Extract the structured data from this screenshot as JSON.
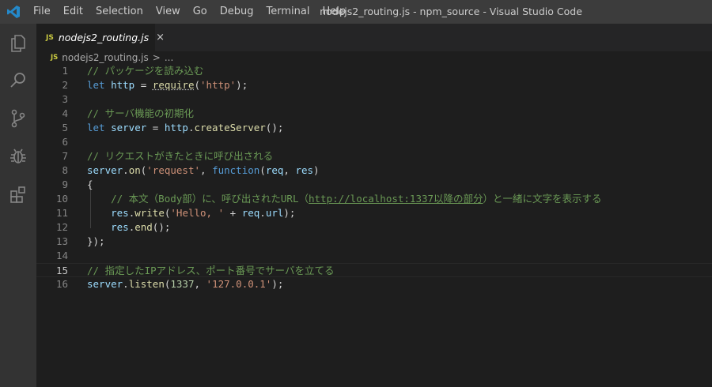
{
  "menu": [
    "File",
    "Edit",
    "Selection",
    "View",
    "Go",
    "Debug",
    "Terminal",
    "Help"
  ],
  "window_title": "nodejs2_routing.js - npm_source - Visual Studio Code",
  "activity_bar": [
    "explorer-icon",
    "search-icon",
    "source-control-icon",
    "debug-icon",
    "extensions-icon"
  ],
  "tab": {
    "badge": "JS",
    "label": "nodejs2_routing.js",
    "close": "×"
  },
  "breadcrumb": {
    "badge": "JS",
    "file": "nodejs2_routing.js",
    "separator": ">",
    "more": "..."
  },
  "editor": {
    "current_line": 15,
    "lines": [
      {
        "n": "1",
        "tokens": [
          {
            "t": "// パッケージを読み込む",
            "c": "cm"
          }
        ]
      },
      {
        "n": "2",
        "tokens": [
          {
            "t": "let ",
            "c": "kw"
          },
          {
            "t": "http",
            "c": "var"
          },
          {
            "t": " = ",
            "c": "pl"
          },
          {
            "t": "require",
            "c": "fn squig"
          },
          {
            "t": "(",
            "c": "pl"
          },
          {
            "t": "'http'",
            "c": "str"
          },
          {
            "t": ");",
            "c": "pl"
          }
        ]
      },
      {
        "n": "3",
        "tokens": []
      },
      {
        "n": "4",
        "tokens": [
          {
            "t": "// サーバ機能の初期化",
            "c": "cm"
          }
        ]
      },
      {
        "n": "5",
        "tokens": [
          {
            "t": "let ",
            "c": "kw"
          },
          {
            "t": "server",
            "c": "var"
          },
          {
            "t": " = ",
            "c": "pl"
          },
          {
            "t": "http",
            "c": "var"
          },
          {
            "t": ".",
            "c": "pl"
          },
          {
            "t": "createServer",
            "c": "fn"
          },
          {
            "t": "();",
            "c": "pl"
          }
        ]
      },
      {
        "n": "6",
        "tokens": []
      },
      {
        "n": "7",
        "tokens": [
          {
            "t": "// リクエストがきたときに呼び出される",
            "c": "cm"
          }
        ]
      },
      {
        "n": "8",
        "tokens": [
          {
            "t": "server",
            "c": "var"
          },
          {
            "t": ".",
            "c": "pl"
          },
          {
            "t": "on",
            "c": "fn"
          },
          {
            "t": "(",
            "c": "pl"
          },
          {
            "t": "'request'",
            "c": "str"
          },
          {
            "t": ", ",
            "c": "pl"
          },
          {
            "t": "function",
            "c": "kw"
          },
          {
            "t": "(",
            "c": "pl"
          },
          {
            "t": "req",
            "c": "var"
          },
          {
            "t": ", ",
            "c": "pl"
          },
          {
            "t": "res",
            "c": "var"
          },
          {
            "t": ")",
            "c": "pl"
          }
        ]
      },
      {
        "n": "9",
        "tokens": [
          {
            "t": "{",
            "c": "pl"
          }
        ]
      },
      {
        "n": "10",
        "tokens": [
          {
            "t": "    // 本文（Body部）に、呼び出されたURL（",
            "c": "cm"
          },
          {
            "t": "http://localhost:1337以降の部分",
            "c": "cm link"
          },
          {
            "t": "）と一緒に文字を表示する",
            "c": "cm"
          }
        ]
      },
      {
        "n": "11",
        "tokens": [
          {
            "t": "    ",
            "c": "pl"
          },
          {
            "t": "res",
            "c": "var"
          },
          {
            "t": ".",
            "c": "pl"
          },
          {
            "t": "write",
            "c": "fn"
          },
          {
            "t": "(",
            "c": "pl"
          },
          {
            "t": "'Hello, '",
            "c": "str"
          },
          {
            "t": " + ",
            "c": "pl"
          },
          {
            "t": "req",
            "c": "var"
          },
          {
            "t": ".",
            "c": "pl"
          },
          {
            "t": "url",
            "c": "var"
          },
          {
            "t": ");",
            "c": "pl"
          }
        ]
      },
      {
        "n": "12",
        "tokens": [
          {
            "t": "    ",
            "c": "pl"
          },
          {
            "t": "res",
            "c": "var"
          },
          {
            "t": ".",
            "c": "pl"
          },
          {
            "t": "end",
            "c": "fn"
          },
          {
            "t": "();",
            "c": "pl"
          }
        ]
      },
      {
        "n": "13",
        "tokens": [
          {
            "t": "});",
            "c": "pl"
          }
        ]
      },
      {
        "n": "14",
        "tokens": []
      },
      {
        "n": "15",
        "tokens": [
          {
            "t": "// 指定したIPアドレス、ポート番号でサーバを立てる",
            "c": "cm"
          }
        ]
      },
      {
        "n": "16",
        "tokens": [
          {
            "t": "server",
            "c": "var"
          },
          {
            "t": ".",
            "c": "pl"
          },
          {
            "t": "listen",
            "c": "fn"
          },
          {
            "t": "(",
            "c": "pl"
          },
          {
            "t": "1337",
            "c": "num"
          },
          {
            "t": ", ",
            "c": "pl"
          },
          {
            "t": "'127.0.0.1'",
            "c": "str"
          },
          {
            "t": ");",
            "c": "pl"
          }
        ]
      }
    ]
  }
}
